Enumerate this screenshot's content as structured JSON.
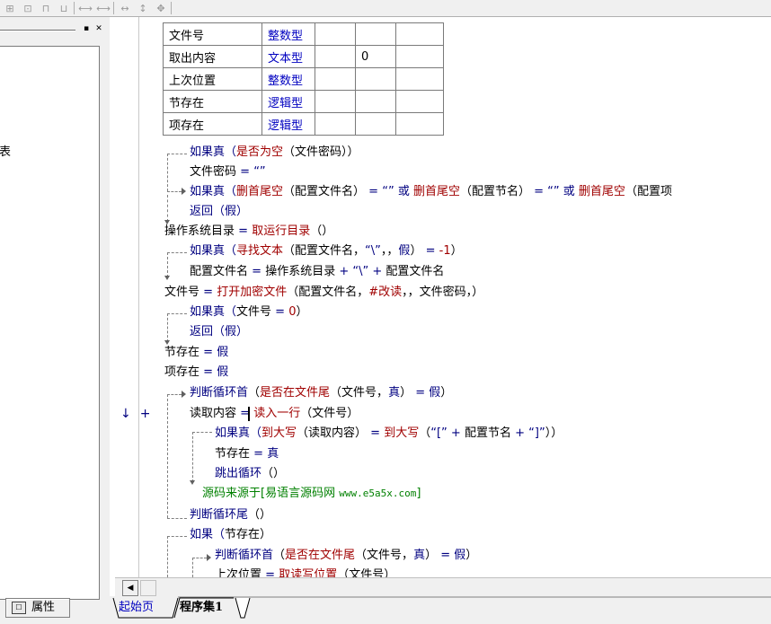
{
  "left_panel": {
    "truncated_text": "表",
    "properties_tab": "属性"
  },
  "variables": [
    {
      "name": "文件号",
      "type": "整数型",
      "c2": "",
      "c3": "",
      "c4": ""
    },
    {
      "name": "取出内容",
      "type": "文本型",
      "c2": "",
      "c3": "0",
      "c4": ""
    },
    {
      "name": "上次位置",
      "type": "整数型",
      "c2": "",
      "c3": "",
      "c4": ""
    },
    {
      "name": "节存在",
      "type": "逻辑型",
      "c2": "",
      "c3": "",
      "c4": ""
    },
    {
      "name": "项存在",
      "type": "逻辑型",
      "c2": "",
      "c3": "",
      "c4": ""
    }
  ],
  "code": {
    "l1": {
      "kw": "如果真（",
      "fn": "是否为空",
      "rest": "（文件密码））"
    },
    "l2": {
      "a": "文件密码",
      "op": " = ",
      "s": "“”"
    },
    "l3": {
      "kw": "如果真（",
      "fn1": "删首尾空",
      "a": "（配置文件名）",
      "op": " = ",
      "s": "“”",
      "or1": " 或 ",
      "fn2": "删首尾空",
      "b": "（配置节名）",
      "op2": " = ",
      "s2": "“”",
      "or2": " 或 ",
      "fn3": "删首尾空",
      "c": "（配置项"
    },
    "l4": {
      "kw": "返回（假）"
    },
    "l5": {
      "a": "操作系统目录",
      "op": " = ",
      "fn": "取运行目录",
      "rest": "（）"
    },
    "l6": {
      "kw": "如果真（",
      "fn": "寻找文本",
      "a": "（配置文件名，",
      "s": "“\\”",
      "b": "，，",
      "kw2": "假",
      "c": "）",
      "op": " = ",
      "n": "-1",
      "d": "）"
    },
    "l7": {
      "a": "配置文件名",
      "op": " = ",
      "b": "操作系统目录",
      "op2": " + ",
      "s": "“\\”",
      "op3": " + ",
      "c": "配置文件名"
    },
    "l8": {
      "a": "文件号",
      "op": " = ",
      "fn": "打开加密文件",
      "b": "（配置文件名，",
      "kw": "#改读",
      "c": "，，文件密码，）"
    },
    "l9": {
      "kw": "如果真（",
      "a": "文件号",
      "op": " = ",
      "n": "0",
      "b": "）"
    },
    "l10": {
      "kw": "返回（假）"
    },
    "l11": {
      "a": "节存在",
      "op": " = ",
      "kw": "假"
    },
    "l12": {
      "a": "项存在",
      "op": " = ",
      "kw": "假"
    },
    "l13": {
      "kw": "判断循环首",
      "a": "（",
      "fn": "是否在文件尾",
      "b": "（文件号，",
      "kw2": "真",
      "c": "）",
      "op": " = ",
      "kw3": "假",
      "d": "）"
    },
    "l14": {
      "a": "读取内容",
      "op": " = ",
      "fn": "读入一行",
      "b": "（文件号）"
    },
    "l15": {
      "kw": "如果真（",
      "fn": "到大写",
      "a": "（读取内容）",
      "op": " = ",
      "fn2": "到大写",
      "b": "（",
      "s": "“[”",
      "op2": " + ",
      "c": "配置节名",
      "op3": " + ",
      "s2": "“]”",
      "d": "））"
    },
    "l16": {
      "a": "节存在",
      "op": " = ",
      "kw": "真"
    },
    "l17": {
      "kw": "跳出循环",
      "a": "（）"
    },
    "l18": {
      "cmt": "源码来源于[易语言源码网 ",
      "url": "www.e5a5x.com",
      "end": "]"
    },
    "l19": {
      "kw": "判断循环尾",
      "a": "（）"
    },
    "l20": {
      "kw": "如果（",
      "a": "节存在",
      "b": "）"
    },
    "l21": {
      "kw": "判断循环首",
      "a": "（",
      "fn": "是否在文件尾",
      "b": "（文件号，",
      "kw2": "真",
      "c": "）",
      "op": " = ",
      "kw3": "假",
      "d": "）"
    },
    "l22": {
      "a": "上次位置",
      "op": " = ",
      "fn": "取读写位置",
      "b": "（文件号）"
    }
  },
  "margin": {
    "down_arrow": "↓",
    "plus": "+"
  },
  "tabs": {
    "start": "起始页",
    "program": "程序集1"
  },
  "colors": {
    "keyword": "#000080",
    "function": "#a00000",
    "comment": "#008000",
    "type": "#0000c0"
  }
}
